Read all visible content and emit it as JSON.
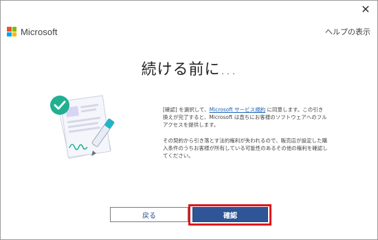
{
  "window": {
    "close_glyph": "✕"
  },
  "header": {
    "brand": "Microsoft",
    "help": "ヘルプの表示",
    "logo_colors": [
      "#f25022",
      "#7fba00",
      "#00a4ef",
      "#ffb900"
    ]
  },
  "title": "続ける前に...",
  "body": {
    "p1_prefix": "[確認] を選択して、",
    "p1_link": "Microsoft サービス規約",
    "p1_suffix": " に同意します。この引き換えが完了すると、Microsoft は直ちにお客様のソフトウェアへのフル アクセスを提供します。",
    "p2": "その契約から引き落とす法的権利が失われるので、販売店が設定した購入条件のうちお客様が所有している可能性のあるその他の権利を確認してください。"
  },
  "buttons": {
    "back": "戻る",
    "confirm": "確認"
  },
  "colors": {
    "accent": "#2f5597",
    "highlight": "#e0131e",
    "check": "#20b08f",
    "link": "#1a5fb4"
  },
  "icons": [
    "close-icon",
    "microsoft-logo-icon",
    "checkmark-icon",
    "document-icon",
    "pen-icon"
  ]
}
